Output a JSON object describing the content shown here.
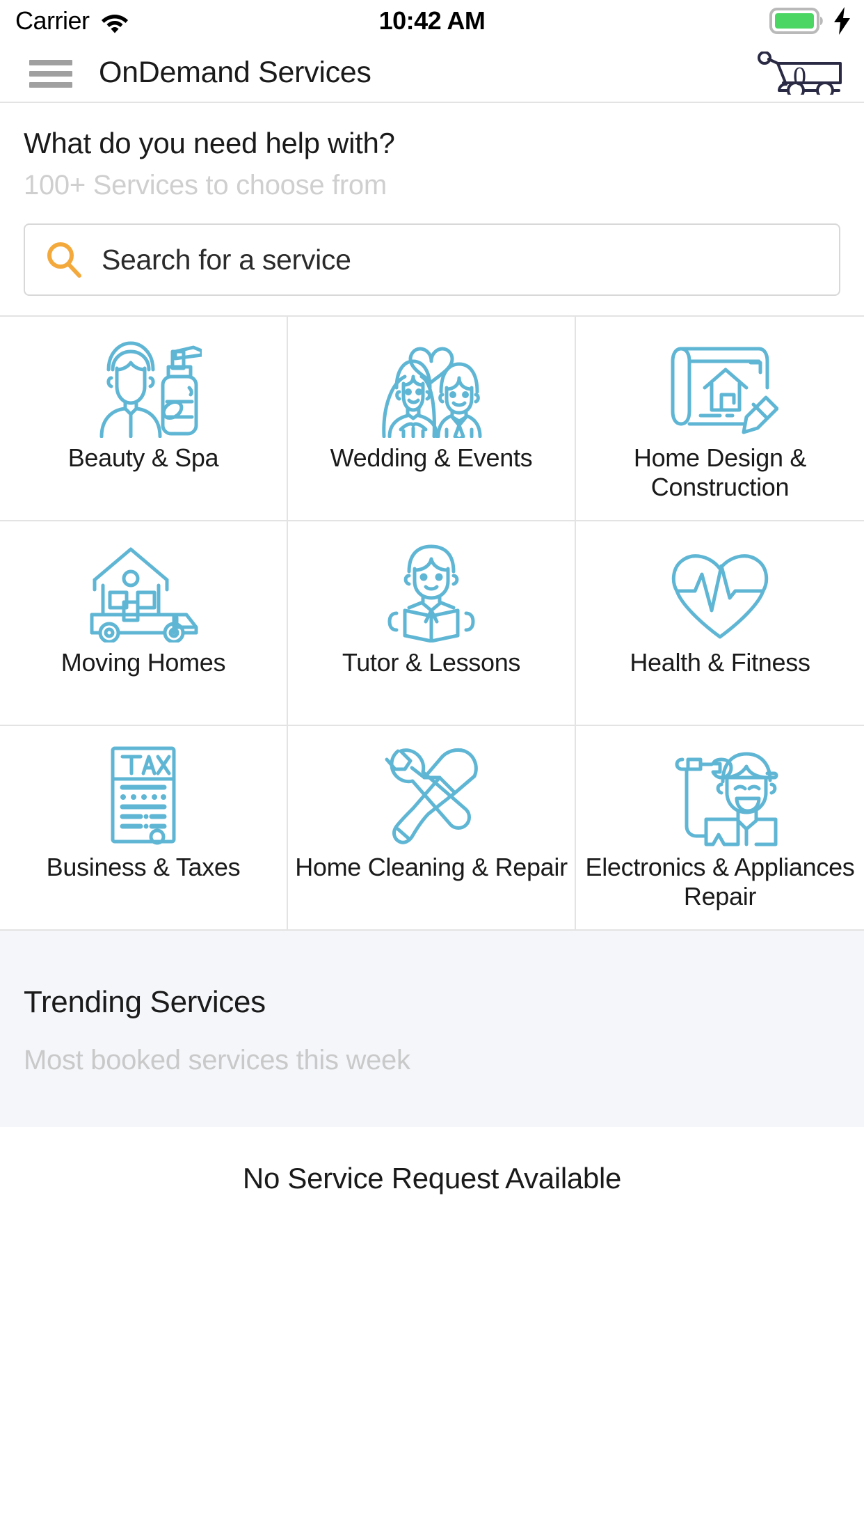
{
  "status_bar": {
    "carrier": "Carrier",
    "time": "10:42 AM",
    "wifi_icon": "wifi-icon",
    "battery_icon": "battery-full-icon",
    "charging_icon": "charging-bolt-icon"
  },
  "nav": {
    "menu_icon": "hamburger-menu-icon",
    "title": "OnDemand Services",
    "cart_icon": "shopping-cart-icon",
    "cart_count": "0"
  },
  "search": {
    "heading": "What do you need help with?",
    "subheading": "100+ Services to choose from",
    "placeholder": "Search for a service",
    "value": "",
    "icon": "search-magnifier-icon",
    "icon_color": "#F4A93D"
  },
  "categories": {
    "icon_color": "#5FB6D4",
    "items": [
      {
        "label": "Beauty & Spa",
        "icon": "beautician-lotion-icon"
      },
      {
        "label": "Wedding & Events",
        "icon": "bride-groom-heart-icon"
      },
      {
        "label": "Home Design & Construction",
        "icon": "blueprint-house-pencil-icon"
      },
      {
        "label": "Moving Homes",
        "icon": "house-on-truck-icon"
      },
      {
        "label": "Tutor & Lessons",
        "icon": "student-book-icon"
      },
      {
        "label": "Health & Fitness",
        "icon": "heart-pulse-icon"
      },
      {
        "label": "Business & Taxes",
        "icon": "tax-document-icon"
      },
      {
        "label": "Home Cleaning & Repair",
        "icon": "hammer-wrench-icon"
      },
      {
        "label": "Electronics & Appliances Repair",
        "icon": "repairman-tools-icon"
      }
    ]
  },
  "trending": {
    "title": "Trending Services",
    "subtitle": "Most booked services this week",
    "background": "#F4F6FA"
  },
  "footer": {
    "message": "No Service Request Available"
  }
}
